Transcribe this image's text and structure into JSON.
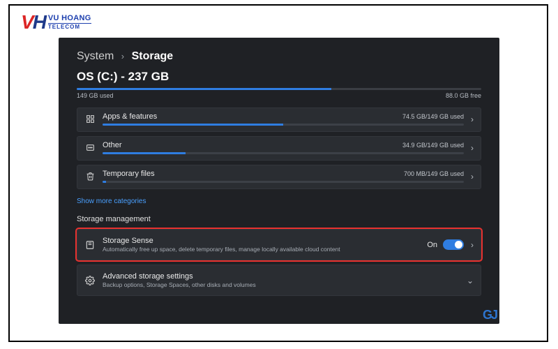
{
  "logo": {
    "line1": "VU HOANG",
    "line2": "TELECOM"
  },
  "breadcrumb": {
    "parent": "System",
    "current": "Storage"
  },
  "drive": {
    "title": "OS (C:) - 237 GB",
    "used_label": "149 GB used",
    "free_label": "88.0 GB free",
    "fill_pct": 63
  },
  "categories": [
    {
      "icon": "grid",
      "name": "Apps & features",
      "used": "74.5 GB/149 GB used",
      "fill_pct": 50
    },
    {
      "icon": "other",
      "name": "Other",
      "used": "34.9 GB/149 GB used",
      "fill_pct": 23
    },
    {
      "icon": "trash",
      "name": "Temporary files",
      "used": "700 MB/149 GB used",
      "fill_pct": 1
    }
  ],
  "show_more": "Show more categories",
  "management_header": "Storage management",
  "storage_sense": {
    "title": "Storage Sense",
    "desc": "Automatically free up space, delete temporary files, manage locally available cloud content",
    "state_label": "On",
    "on": true
  },
  "advanced": {
    "title": "Advanced storage settings",
    "desc": "Backup options, Storage Spaces, other disks and volumes"
  },
  "corner_mark": "GJ"
}
